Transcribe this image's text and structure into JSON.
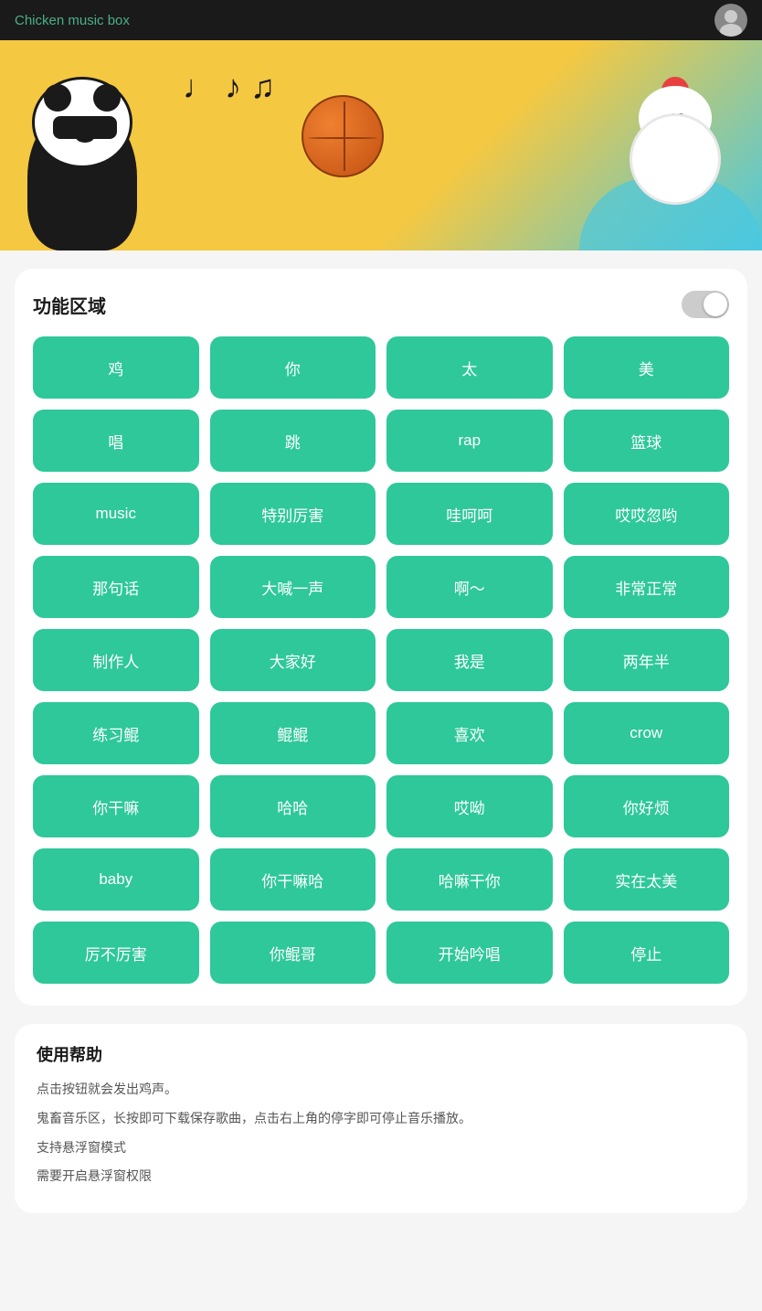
{
  "header": {
    "title": "Chicken music box",
    "avatar_label": "user-avatar"
  },
  "section": {
    "title": "功能区域",
    "toggle_state": "off"
  },
  "buttons": [
    "鸡",
    "你",
    "太",
    "美",
    "唱",
    "跳",
    "rap",
    "篮球",
    "music",
    "特别厉害",
    "哇呵呵",
    "哎哎忽哟",
    "那句话",
    "大喊一声",
    "啊～",
    "非常正常",
    "制作人",
    "大家好",
    "我是",
    "两年半",
    "练习鲲",
    "鲲鲲",
    "喜欢",
    "crow",
    "你干嘛",
    "哈哈",
    "哎呦",
    "你好烦",
    "baby",
    "你干嘛哈",
    "哈嘛干你",
    "实在太美",
    "厉不厉害",
    "你鲲哥",
    "开始吟唱",
    "停止"
  ],
  "help": {
    "title": "使用帮助",
    "lines": [
      "点击按钮就会发出鸡声。",
      "鬼畜音乐区，长按即可下载保存歌曲，点击右上角的停字即可停止音乐播放。",
      "支持悬浮窗模式",
      "需要开启悬浮窗权限"
    ]
  }
}
